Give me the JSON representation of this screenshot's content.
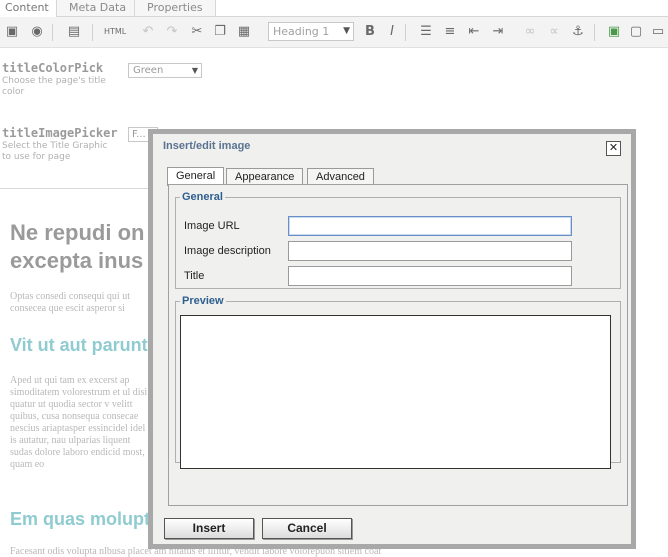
{
  "cms": {
    "tabs": [
      "Content",
      "Meta Data",
      "Properties"
    ],
    "toolbar": {
      "format_value": "Heading 1",
      "html_label": "HTML"
    },
    "fields": [
      {
        "name": "titleColorPick",
        "help": "Choose the page's title color",
        "value": "Green"
      },
      {
        "name": "titleImagePicker",
        "help": "Select the Title Graphic to use for page",
        "value": "F..."
      }
    ],
    "content": {
      "heading1": "Ne repudi on excepta inus",
      "para1": "Optas consedi consequi qui ut consecea que escit asperor si",
      "heading2": "Vit ut aut paruntium",
      "para2": "Aped ut qui tam ex excerst ap simoditatem volorestrum et ul disi quatur ut quodia sector v velitt quibus, cusa nonsequa consecae nescius ariaptasper essincidel idel is autatur, nau ulparias liquent sudas dolore laboro endicid most, quam eo",
      "heading3": "Em quas molupta",
      "bottom": "Facesant odis volupta nlbusa placet am nitatus et illitur, vendit labore volorepuon sitiem coat"
    }
  },
  "dialog": {
    "title": "Insert/edit image",
    "close_label": "✕",
    "tabs": [
      "General",
      "Appearance",
      "Advanced"
    ],
    "general": {
      "legend": "General",
      "fields": [
        {
          "label": "Image URL",
          "value": ""
        },
        {
          "label": "Image description",
          "value": ""
        },
        {
          "label": "Title",
          "value": ""
        }
      ]
    },
    "preview": {
      "legend": "Preview"
    },
    "buttons": {
      "insert": "Insert",
      "cancel": "Cancel"
    }
  }
}
